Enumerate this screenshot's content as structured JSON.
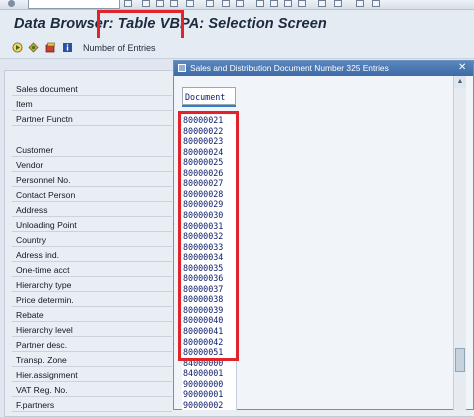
{
  "title": "Data Browser: Table VBPA: Selection Screen",
  "toolbar": {
    "number_of_entries": "Number of Entries",
    "icons": [
      "execute-icon",
      "multiple-selection-icon",
      "save-variant-icon",
      "info-icon"
    ]
  },
  "selection_fields": [
    "Sales document",
    "Item",
    "Partner Functn",
    "Customer",
    "Vendor",
    "Personnel No.",
    "Contact Person",
    "Address",
    "Unloading Point",
    "Country",
    "Adress ind.",
    "One-time acct",
    "Hierarchy type",
    "Price determin.",
    "Rebate",
    "Hierarchy level",
    "Partner desc.",
    "Transp. Zone",
    "Hier.assignment",
    "VAT Reg. No.",
    "F.partners"
  ],
  "popup": {
    "title": "Sales and Distribution Document Number 325 Entries",
    "column_header": "Document",
    "rows": [
      "80000021",
      "80000022",
      "80000023",
      "80000024",
      "80000025",
      "80000026",
      "80000027",
      "80000028",
      "80000029",
      "80000030",
      "80000031",
      "80000032",
      "80000033",
      "80000034",
      "80000035",
      "80000036",
      "80000037",
      "80000038",
      "80000039",
      "80000040",
      "80000041",
      "80000042",
      "80000051",
      "84000000",
      "84000001",
      "90000000",
      "90000001",
      "90000002"
    ]
  },
  "colors": {
    "highlight": "#e0242a",
    "popup_header": "#3e6aa5",
    "list_text": "#0a1a6a"
  }
}
